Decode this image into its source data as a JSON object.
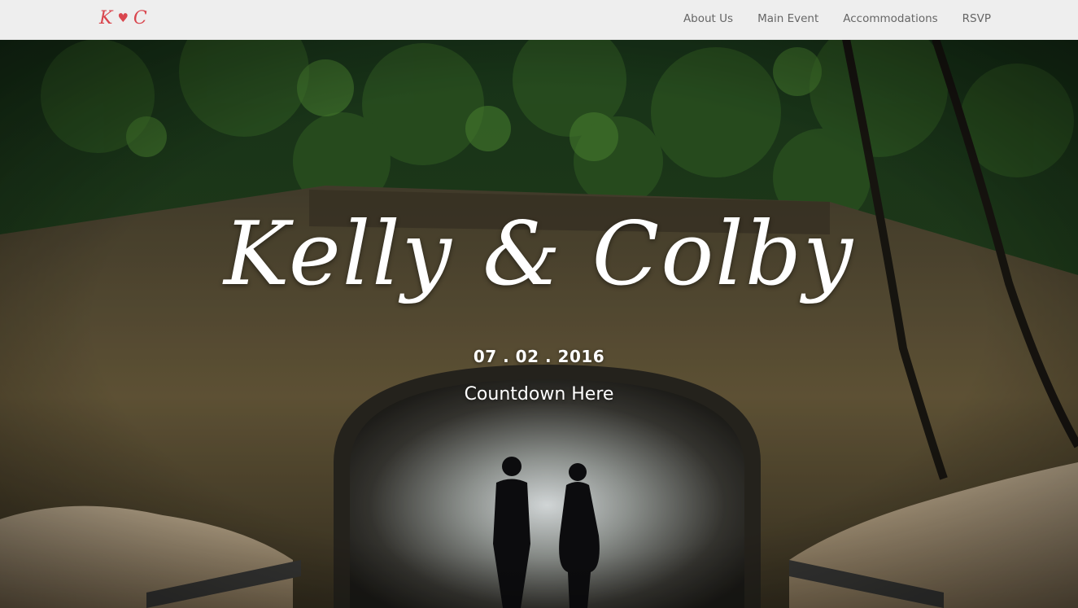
{
  "navbar": {
    "brand": {
      "left": "K",
      "heart": "♥",
      "right": "C"
    },
    "links": [
      {
        "label": "About Us"
      },
      {
        "label": "Main Event"
      },
      {
        "label": "Accommodations"
      },
      {
        "label": "RSVP"
      }
    ]
  },
  "hero": {
    "title": "Kelly & Colby",
    "date": "07 . 02 . 2016",
    "countdown": "Countdown Here"
  },
  "colors": {
    "brand": "#d9464e",
    "nav_text": "#666666",
    "navbar_bg": "#f8f8f8",
    "hero_text": "#ffffff"
  }
}
